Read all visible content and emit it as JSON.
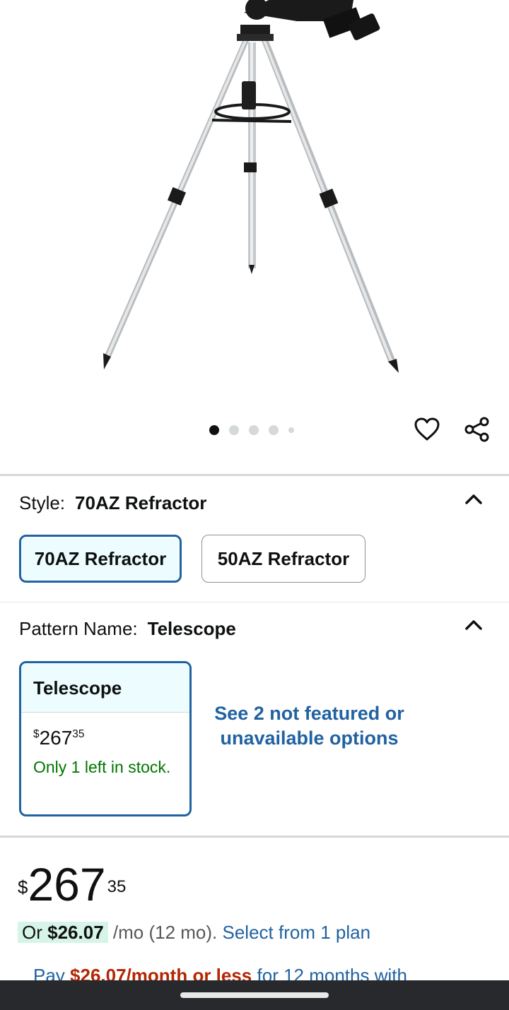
{
  "gallery": {
    "image_alt": "Refractor telescope on aluminum tripod",
    "dots_total": 5,
    "active_dot": 1
  },
  "style_section": {
    "label": "Style:",
    "selected_value": "70AZ Refractor",
    "options": [
      "70AZ Refractor",
      "50AZ Refractor"
    ]
  },
  "pattern_section": {
    "label": "Pattern Name:",
    "selected_value": "Telescope",
    "card": {
      "title": "Telescope",
      "price_currency": "$",
      "price_whole": "267",
      "price_cents": "35",
      "stock": "Only 1 left in stock."
    },
    "see_more": "See 2 not featured or unavailable options"
  },
  "pricing": {
    "currency": "$",
    "whole": "267",
    "cents": "35",
    "monthly_prefix": "Or",
    "monthly_amount": "$26.07",
    "monthly_suffix": "/mo (12 mo).",
    "plan_link": "Select from 1 plan",
    "pay_prefix": "Pay",
    "pay_amount": "$26.07/month or less",
    "pay_suffix": "for 12 months with"
  },
  "colors": {
    "link": "#2162a1",
    "selected_border": "#2162a1",
    "selected_bg": "#edfdff",
    "in_stock": "#007600",
    "deal_red": "#b12704",
    "highlight": "#d6f4e8"
  }
}
